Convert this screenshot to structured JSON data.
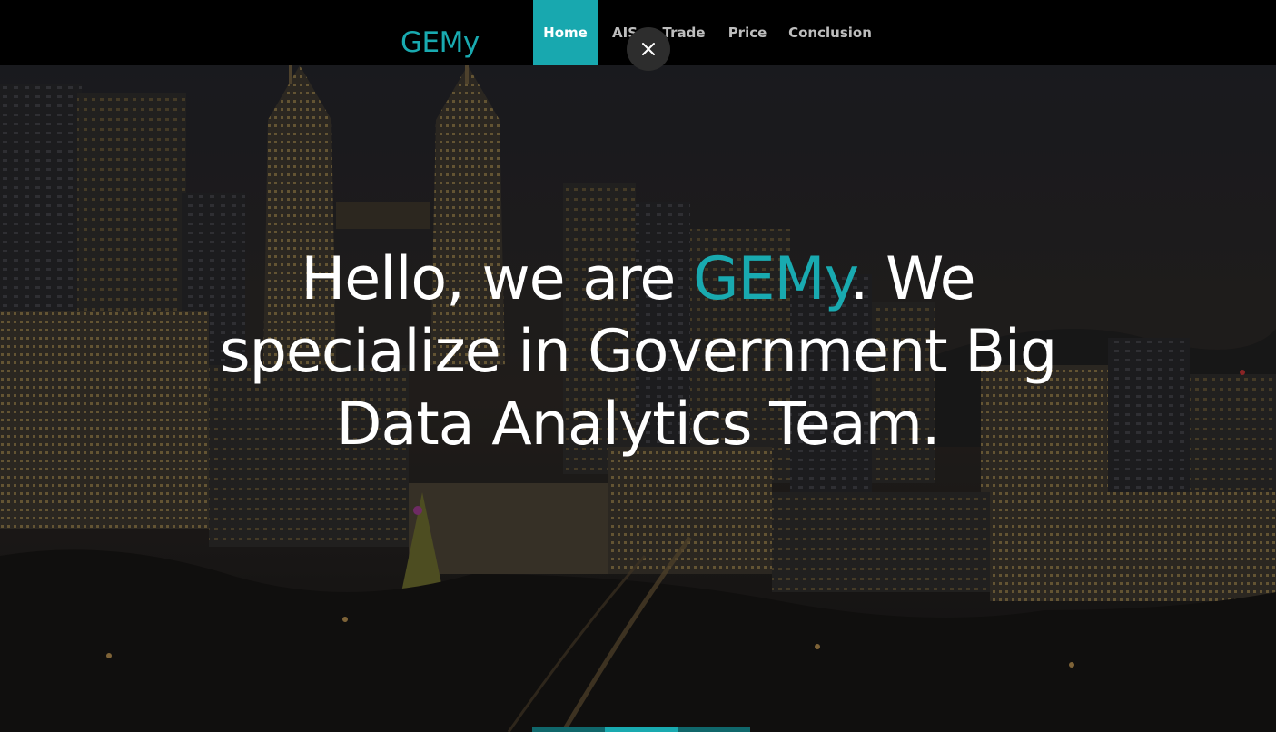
{
  "navbar": {
    "brand": "GEMy",
    "items": [
      {
        "label": "Home",
        "active": true
      },
      {
        "label": "AIS",
        "active": false
      },
      {
        "label": "Trade",
        "active": false
      },
      {
        "label": "Price",
        "active": false
      },
      {
        "label": "Conclusion",
        "active": false
      }
    ],
    "close_icon": "close-icon"
  },
  "hero": {
    "headline_part1": "Hello, we are ",
    "headline_brand": "GEMy",
    "headline_part2": ". We",
    "headline_line2": "specialize in Government Big",
    "headline_line3": "Data Analytics Team.",
    "background": "night city skyline with twin towers"
  },
  "slider": {
    "progress": 0.5
  },
  "colors": {
    "accent": "#19aab0",
    "navbar_bg": "#000000",
    "nav_text": "#bdbdbd",
    "headline_text": "#ffffff"
  }
}
